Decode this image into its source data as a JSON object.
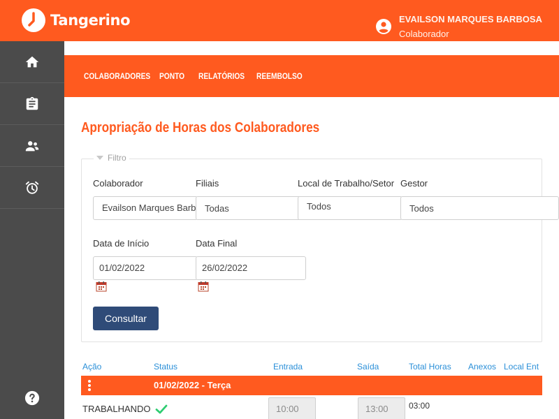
{
  "app": {
    "name": "Tangerino"
  },
  "user": {
    "name": "EVAILSON MARQUES BARBOSA",
    "role": "Colaborador"
  },
  "sidebar": {
    "items": [
      "home-icon",
      "clipboard-icon",
      "people-icon",
      "alarm-icon"
    ],
    "help": "help-icon"
  },
  "nav": {
    "items": [
      "COLABORADORES",
      "PONTO",
      "RELATÓRIOS",
      "REEMBOLSO"
    ]
  },
  "page": {
    "title": "Apropriação de Horas dos Colaboradores"
  },
  "filter": {
    "legend": "Filtro",
    "colaborador_label": "Colaborador",
    "colaborador_value": "Evailson Marques Barbosa",
    "filiais_label": "Filiais",
    "filiais_value": "Todas",
    "local_label": "Local de Trabalho/Setor",
    "local_value": "Todos",
    "gestor_label": "Gestor",
    "gestor_value": "Todos",
    "data_inicio_label": "Data de Início",
    "data_inicio_value": "01/02/2022",
    "data_final_label": "Data Final",
    "data_final_value": "26/02/2022",
    "consultar": "Consultar"
  },
  "table": {
    "headers": [
      "Ação",
      "Status",
      "Entrada",
      "Saída",
      "Total Horas",
      "Anexos",
      "Local Ent"
    ],
    "day": "01/02/2022 - Terça",
    "row": {
      "status": "TRABALHANDO",
      "entrada": "10:00",
      "saida": "13:00",
      "total": "03:00"
    }
  },
  "colors": {
    "accent": "#ff5a1f",
    "sidebar": "#4b4b4b",
    "button": "#2f4b78",
    "link": "#2a8fd8",
    "success": "#2ecc71"
  }
}
